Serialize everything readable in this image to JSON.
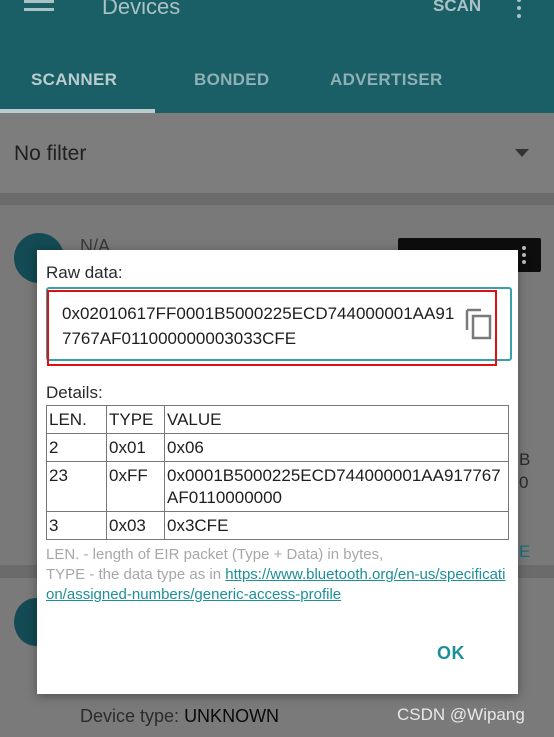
{
  "app": {
    "title": "Devices",
    "scan_label": "SCAN",
    "tabs": [
      "SCANNER",
      "BONDED",
      "ADVERTISER"
    ],
    "filter_label": "No filter"
  },
  "background": {
    "device_name": "N/A",
    "side_char_1": "B",
    "side_char_2": "0",
    "side_char_3": "E",
    "device_type_label": "Device type:",
    "device_type_value": "UNKNOWN"
  },
  "dialog": {
    "raw_label": "Raw data:",
    "raw_value": "0x02010617FF0001B5000225ECD744000001AA917767AF011000000003033CFE",
    "details_label": "Details:",
    "table_headers": [
      "LEN.",
      "TYPE",
      "VALUE"
    ],
    "rows": [
      {
        "len": "2",
        "type": "0x01",
        "value": "0x06"
      },
      {
        "len": "23",
        "type": "0xFF",
        "value": "0x0001B5000225ECD744000001AA917767AF0110000000"
      },
      {
        "len": "3",
        "type": "0x03",
        "value": "0x3CFE"
      }
    ],
    "legend_line1": "LEN. - length of EIR packet (Type + Data) in bytes,",
    "legend_line2_prefix": "TYPE - the data type as in ",
    "legend_link": "https://www.bluetooth.org/en-us/specification/assigned-numbers/generic-access-profile",
    "ok_label": "OK"
  },
  "watermark": "CSDN @Wipang",
  "colors": {
    "accent": "#1c8f9a",
    "highlight": "#e01010",
    "appbar": "#1a5e66"
  }
}
